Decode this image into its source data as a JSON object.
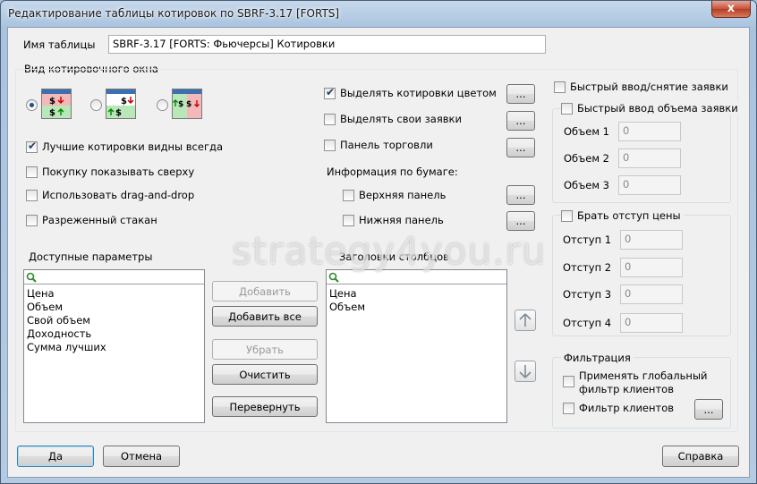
{
  "window": {
    "title": "Редактирование таблицы котировок по SBRF-3.17 [FORTS]",
    "close_glyph": "x"
  },
  "table_name": {
    "label": "Имя таблицы",
    "value": "SBRF-3.17 [FORTS: Фьючерсы] Котировки"
  },
  "view_group": {
    "label": "Вид котировочного окна",
    "selected_radio": 0
  },
  "left_checks": [
    {
      "label": "Лучшие котировки видны всегда",
      "checked": true
    },
    {
      "label": "Покупку показывать сверху",
      "checked": false
    },
    {
      "label": "Использовать drag-and-drop",
      "checked": false
    },
    {
      "label": "Разреженный стакан",
      "checked": false
    }
  ],
  "mid_checks": [
    {
      "label": "Выделять котировки цветом",
      "checked": true
    },
    {
      "label": "Выделять свои заявки",
      "checked": false
    },
    {
      "label": "Панель торговли",
      "checked": false
    }
  ],
  "security_info": {
    "label": "Информация по бумаге:",
    "items": [
      {
        "label": "Верхняя панель",
        "checked": false
      },
      {
        "label": "Нижняя панель",
        "checked": false
      }
    ]
  },
  "dots_label": "...",
  "available": {
    "label": "Доступные параметры",
    "items": [
      "Цена",
      "Объем",
      "Свой объем",
      "Доходность",
      "Сумма лучших"
    ]
  },
  "headers": {
    "label": "Заголовки столбцов",
    "items": [
      "Цена",
      "Объем"
    ]
  },
  "buttons": {
    "add": "Добавить",
    "add_all": "Добавить все",
    "remove": "Убрать",
    "clear": "Очистить",
    "reverse": "Перевернуть",
    "ok": "Да",
    "cancel": "Отмена",
    "help": "Справка"
  },
  "quick": {
    "quick_order": "Быстрый ввод/снятие заявки",
    "quick_volume": "Быстрый ввод объема заявки",
    "volumes": [
      {
        "label": "Объем 1",
        "value": "0"
      },
      {
        "label": "Объем 2",
        "value": "0"
      },
      {
        "label": "Объем 3",
        "value": "0"
      }
    ]
  },
  "offset": {
    "label": "Брать отступ цены",
    "items": [
      {
        "label": "Отступ 1",
        "value": "0"
      },
      {
        "label": "Отступ 2",
        "value": "0"
      },
      {
        "label": "Отступ 3",
        "value": "0"
      },
      {
        "label": "Отступ 4",
        "value": "0"
      }
    ]
  },
  "filter": {
    "label": "Фильтрация",
    "global_line1": "Применять глобальный",
    "global_line2": "фильтр клиентов",
    "client": "Фильтр клиентов"
  },
  "watermark": "strategy4you.ru",
  "colors": {
    "sell": "#f3b9b9",
    "buy": "#b9e7b9",
    "title_bar": "#c7d8eb"
  }
}
